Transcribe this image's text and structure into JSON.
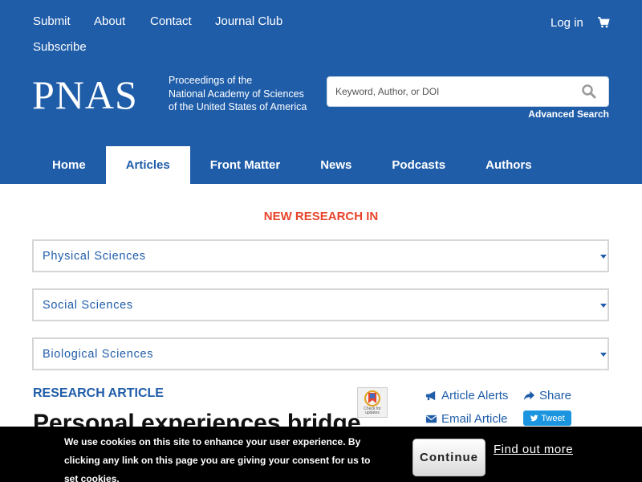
{
  "utility_nav": {
    "submit": "Submit",
    "about": "About",
    "contact": "Contact",
    "journal_club": "Journal Club",
    "subscribe": "Subscribe",
    "login": "Log in",
    "cart_icon": "shopping-cart-icon"
  },
  "brand": {
    "logo": "PNAS",
    "tagline_line1": "Proceedings of the",
    "tagline_line2": "National Academy of Sciences",
    "tagline_line3": "of the United States of America"
  },
  "search": {
    "placeholder": "Keyword, Author, or DOI",
    "value": "",
    "icon": "search-icon",
    "advanced_label": "Advanced Search"
  },
  "main_nav": {
    "items": [
      {
        "label": "Home",
        "active": false
      },
      {
        "label": "Articles",
        "active": true
      },
      {
        "label": "Front Matter",
        "active": false
      },
      {
        "label": "News",
        "active": false
      },
      {
        "label": "Podcasts",
        "active": false
      },
      {
        "label": "Authors",
        "active": false
      }
    ]
  },
  "new_research": {
    "heading": "NEW RESEARCH IN",
    "selects": [
      {
        "label": "Physical Sciences"
      },
      {
        "label": "Social Sciences"
      },
      {
        "label": "Biological Sciences"
      }
    ]
  },
  "article": {
    "type": "RESEARCH ARTICLE",
    "title_visible": "Personal experiences bridge",
    "crossmark_text": "Check for updates"
  },
  "tools": {
    "alerts": "Article Alerts",
    "share": "Share",
    "email": "Email Article",
    "tweet": "Tweet"
  },
  "cookie_banner": {
    "message": "We use cookies on this site to enhance your user experience. By clicking any link on this page you are giving your consent for us to set cookies.",
    "continue_label": "Continue",
    "find_out_more": "Find out more"
  },
  "colors": {
    "brand_blue": "#1f5da9",
    "accent_red": "#e8452c",
    "twitter_blue": "#1b95e0"
  }
}
